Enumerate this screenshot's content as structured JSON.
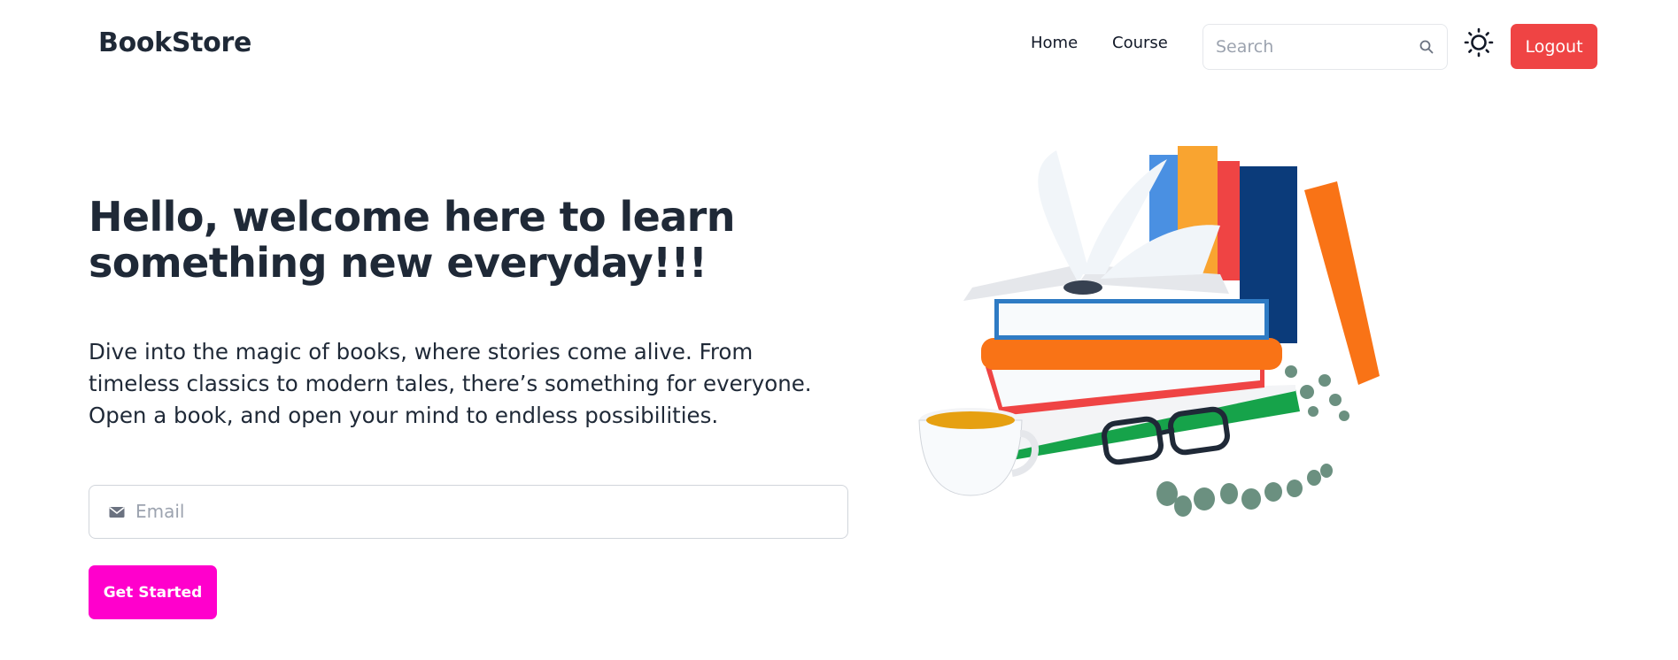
{
  "navbar": {
    "brand": "BookStore",
    "links": [
      {
        "label": "Home"
      },
      {
        "label": "Course"
      }
    ],
    "search": {
      "placeholder": "Search",
      "value": "",
      "icon": "search-icon"
    },
    "theme_toggle_icon": "sun-icon",
    "logout_label": "Logout"
  },
  "hero": {
    "title_line1": "Hello, welcome here to learn",
    "title_line2": "something new everyday!!!",
    "description_lines": [
      "Dive into the magic of books, where stories come alive. From",
      "timeless classics to modern tales, there’s something for everyone.",
      "Open a book, and open your mind to endless possibilities."
    ],
    "email": {
      "placeholder": "Email",
      "value": "",
      "icon": "mail-icon"
    },
    "cta_label": "Get Started",
    "illustration": "books-stack-illustration"
  },
  "colors": {
    "logout": "#ef4444",
    "cta": "#ff00cc",
    "text": "#1f2937"
  }
}
